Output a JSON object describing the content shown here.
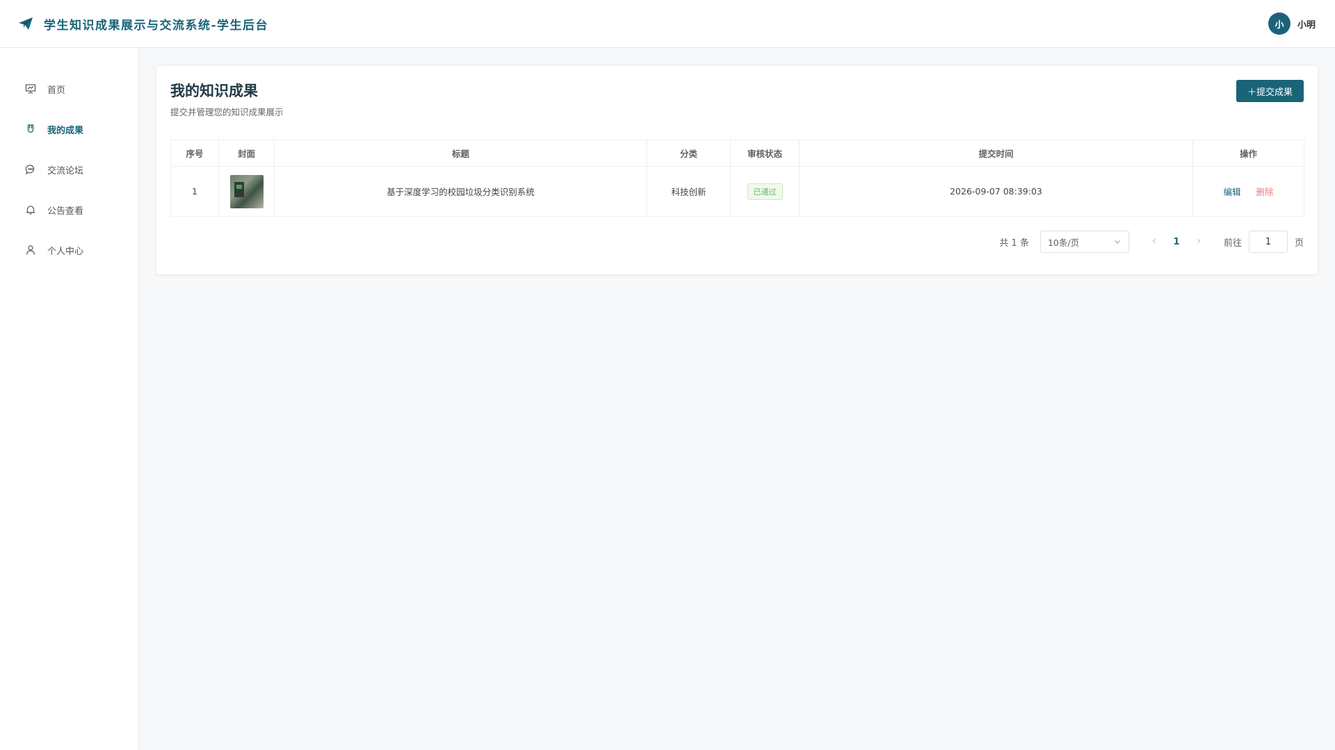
{
  "header": {
    "title": "学生知识成果展示与交流系统-学生后台",
    "user": {
      "avatar_text": "小",
      "name": "小明"
    }
  },
  "sidebar": {
    "items": [
      {
        "label": "首页",
        "icon": "presentation-icon"
      },
      {
        "label": "我的成果",
        "icon": "medal-icon",
        "active": true
      },
      {
        "label": "交流论坛",
        "icon": "chat-bubble-icon"
      },
      {
        "label": "公告查看",
        "icon": "bell-icon"
      },
      {
        "label": "个人中心",
        "icon": "user-icon"
      }
    ]
  },
  "main": {
    "title": "我的知识成果",
    "subtitle": "提交并管理您的知识成果展示",
    "submit_button": "＋提交成果",
    "table": {
      "columns": [
        "序号",
        "封面",
        "标题",
        "分类",
        "审核状态",
        "提交时间",
        "操作"
      ],
      "rows": [
        {
          "index": "1",
          "title": "基于深度学习的校园垃圾分类识别系统",
          "category": "科技创新",
          "status": "已通过",
          "time": "2026-09-07 08:39:03",
          "edit": "编辑",
          "delete": "删除"
        }
      ]
    },
    "pagination": {
      "total": "共 1 条",
      "page_size": "10条/页",
      "current": "1",
      "goto_label": "前往",
      "goto_value": "1",
      "goto_unit": "页"
    }
  },
  "colors": {
    "primary": "#1a6478",
    "danger": "#f07a7a",
    "success": "#5fb85f"
  }
}
